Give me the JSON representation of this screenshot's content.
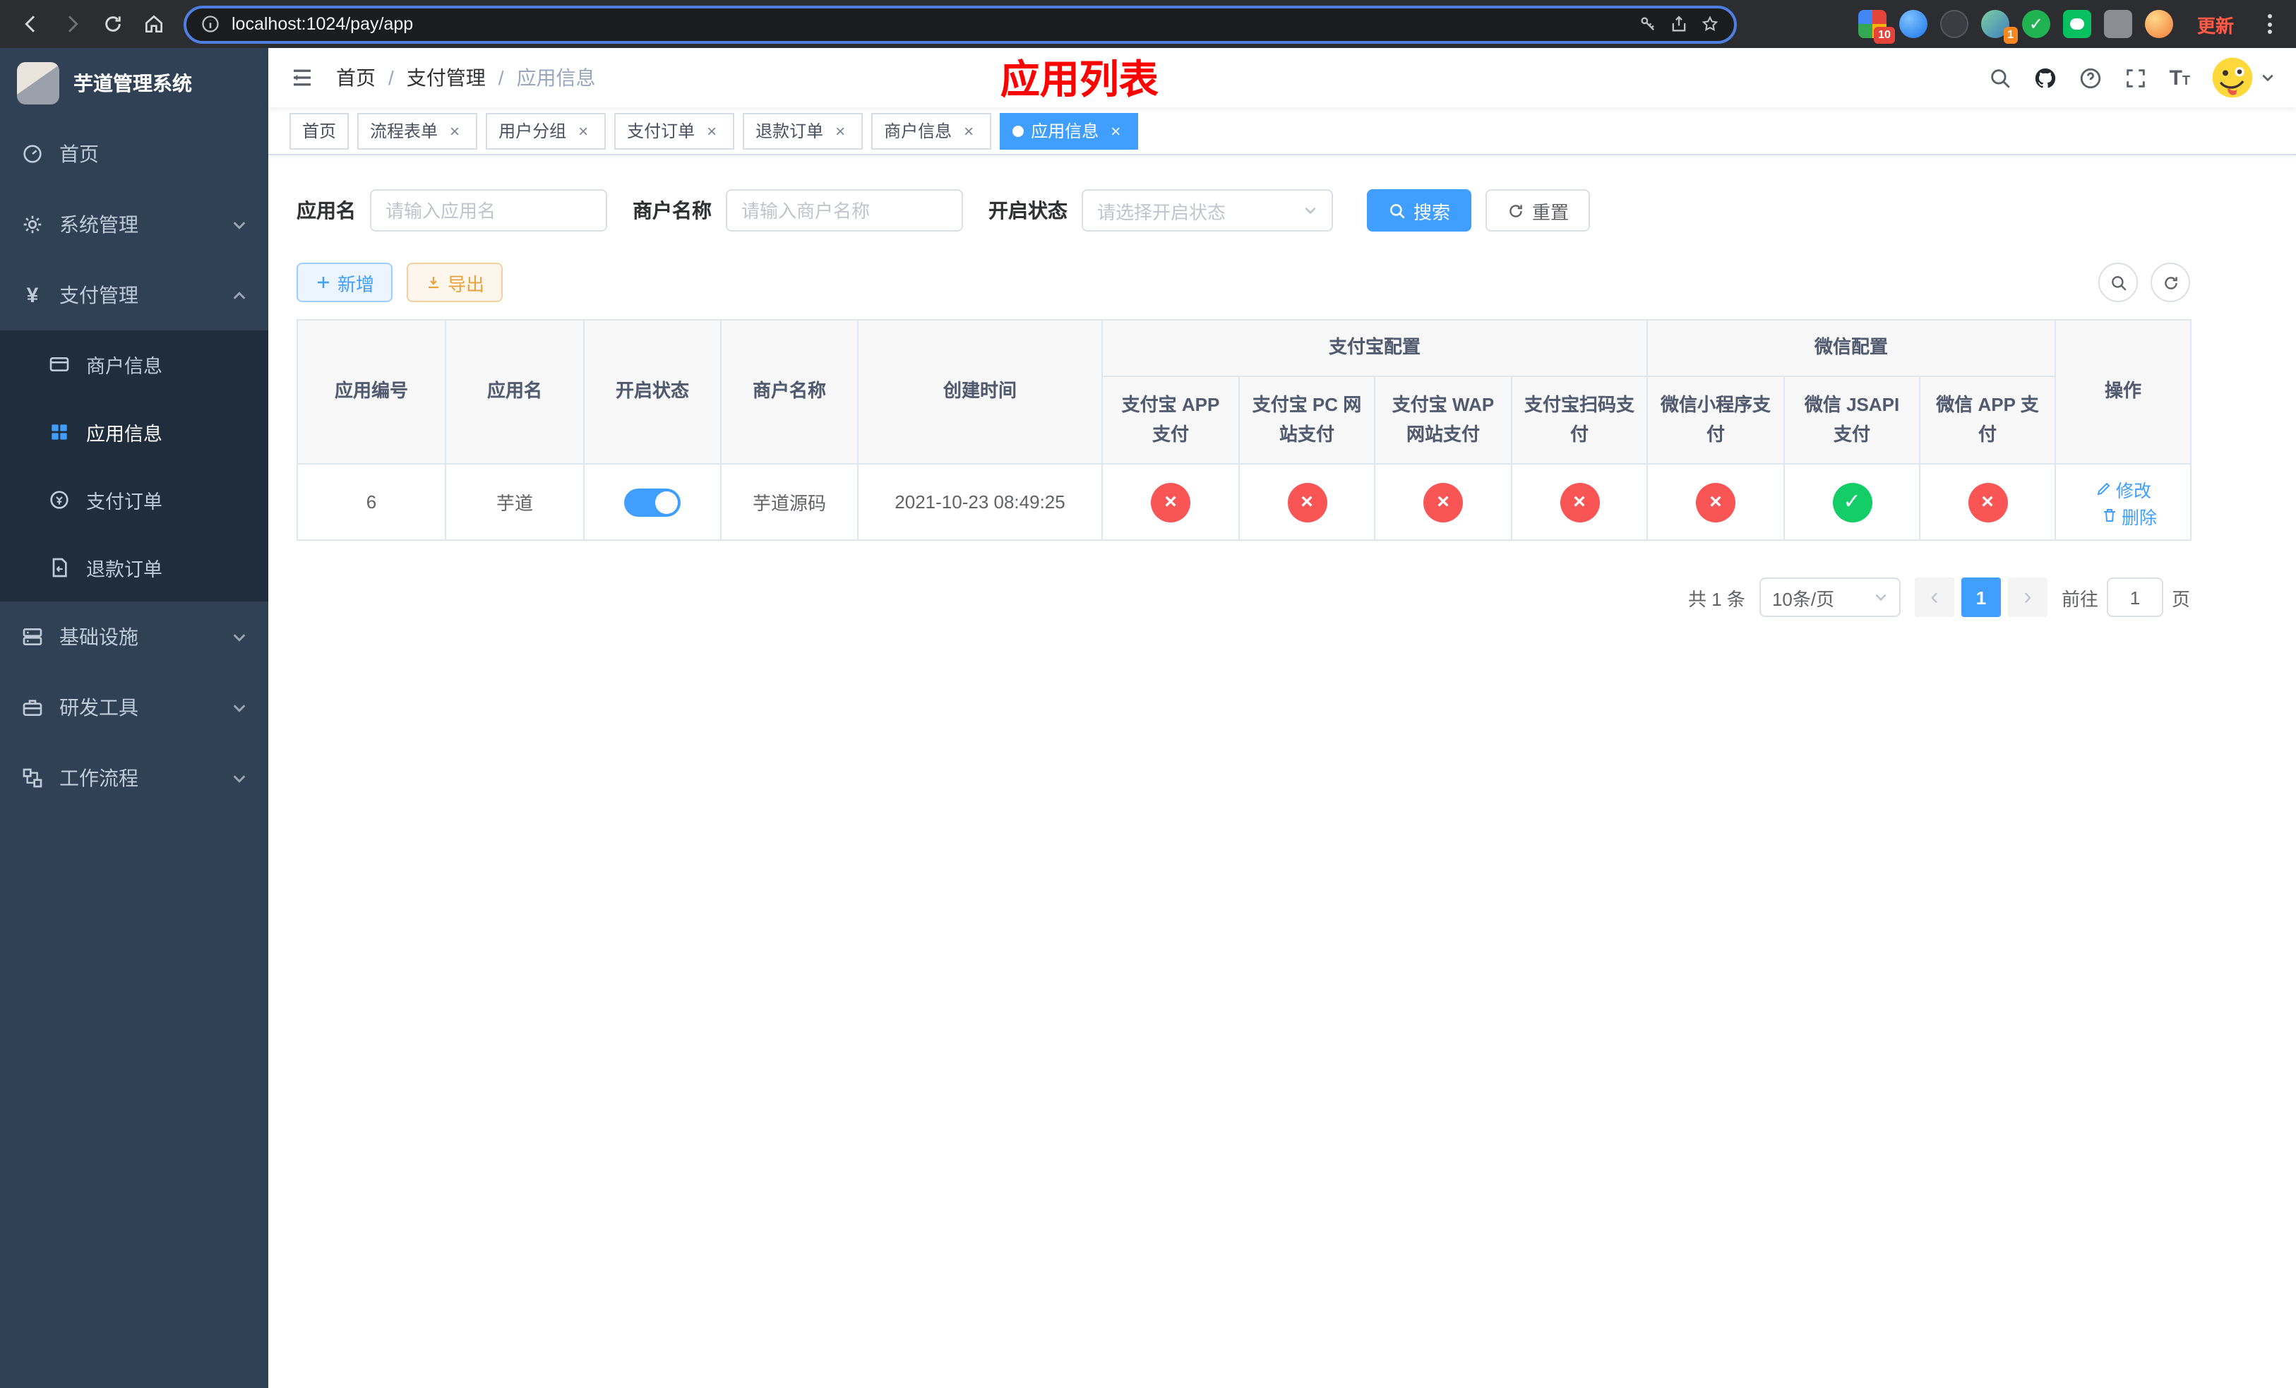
{
  "icons": {
    "close": "×",
    "check": "✓",
    "cross": "×",
    "prev": "‹",
    "next": "›"
  },
  "colors": {
    "accent": "#409eff",
    "danger": "#fa5555",
    "success": "#13ce66",
    "warning": "#e6a23c",
    "title_red": "#ff0000"
  },
  "browser": {
    "url": "localhost:1024/pay/app",
    "update_label": "更新",
    "grid_badge": "10",
    "avatar_badge": "1"
  },
  "sidebar": {
    "title": "芋道管理系统",
    "items": [
      {
        "label": "首页"
      },
      {
        "label": "系统管理"
      },
      {
        "label": "支付管理"
      },
      {
        "label": "基础设施"
      },
      {
        "label": "研发工具"
      },
      {
        "label": "工作流程"
      }
    ],
    "payment_children": [
      {
        "label": "商户信息"
      },
      {
        "label": "应用信息"
      },
      {
        "label": "支付订单"
      },
      {
        "label": "退款订单"
      }
    ]
  },
  "header": {
    "breadcrumb": [
      "首页",
      "支付管理",
      "应用信息"
    ],
    "separator": "/",
    "page_title": "应用列表"
  },
  "tabs": [
    {
      "label": "首页"
    },
    {
      "label": "流程表单"
    },
    {
      "label": "用户分组"
    },
    {
      "label": "支付订单"
    },
    {
      "label": "退款订单"
    },
    {
      "label": "商户信息"
    },
    {
      "label": "应用信息"
    }
  ],
  "filters": {
    "app_name_label": "应用名",
    "app_name_placeholder": "请输入应用名",
    "merchant_label": "商户名称",
    "merchant_placeholder": "请输入商户名称",
    "status_label": "开启状态",
    "status_placeholder": "请选择开启状态",
    "search_label": "搜索",
    "reset_label": "重置"
  },
  "toolbar": {
    "add_label": "新增",
    "export_label": "导出"
  },
  "table": {
    "plain_columns": [
      "应用编号",
      "应用名",
      "开启状态",
      "商户名称",
      "创建时间"
    ],
    "alipay_group_label": "支付宝配置",
    "alipay_columns": [
      "支付宝 APP 支付",
      "支付宝 PC 网站支付",
      "支付宝 WAP 网站支付",
      "支付宝扫码支付"
    ],
    "wechat_group_label": "微信配置",
    "wechat_columns": [
      "微信小程序支付",
      "微信 JSAPI 支付",
      "微信 APP 支付"
    ],
    "action_column": "操作",
    "rows": [
      {
        "id": "6",
        "name": "芋道",
        "enabled": true,
        "merchant": "芋道源码",
        "created_at": "2021-10-23 08:49:25",
        "pay_status": {
          "alipay_app": false,
          "alipay_pc": false,
          "alipay_wap": false,
          "alipay_scan": false,
          "wechat_mini": false,
          "wechat_jsapi": true,
          "wechat_app": false
        },
        "edit_label": "修改",
        "delete_label": "删除"
      }
    ]
  },
  "pagination": {
    "total_label": "共 1 条",
    "page_size_label": "10条/页",
    "current_page": "1",
    "goto_label": "前往",
    "goto_value": "1",
    "goto_suffix": "页"
  }
}
